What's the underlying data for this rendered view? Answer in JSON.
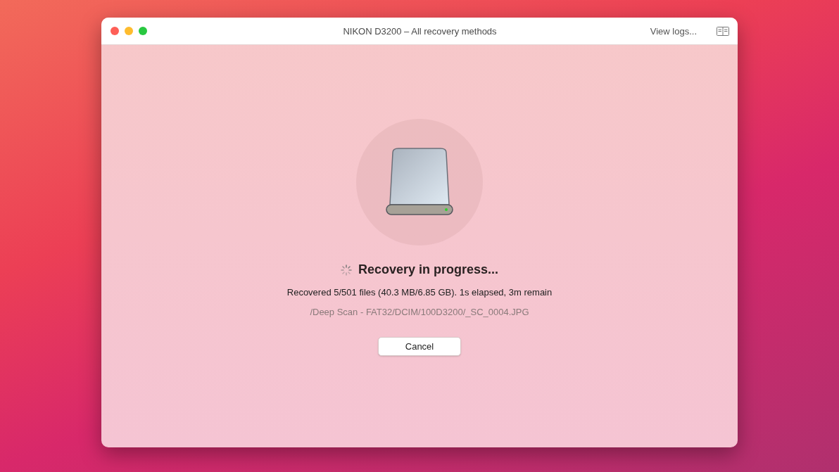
{
  "window": {
    "title": "NIKON D3200 – All recovery methods",
    "view_logs": "View logs..."
  },
  "progress": {
    "heading": "Recovery in progress...",
    "status": "Recovered 5/501 files (40.3 MB/6.85 GB). 1s elapsed, 3m remain",
    "current_file": "/Deep Scan - FAT32/DCIM/100D3200/_SC_0004.JPG"
  },
  "buttons": [
    "Cancel"
  ]
}
